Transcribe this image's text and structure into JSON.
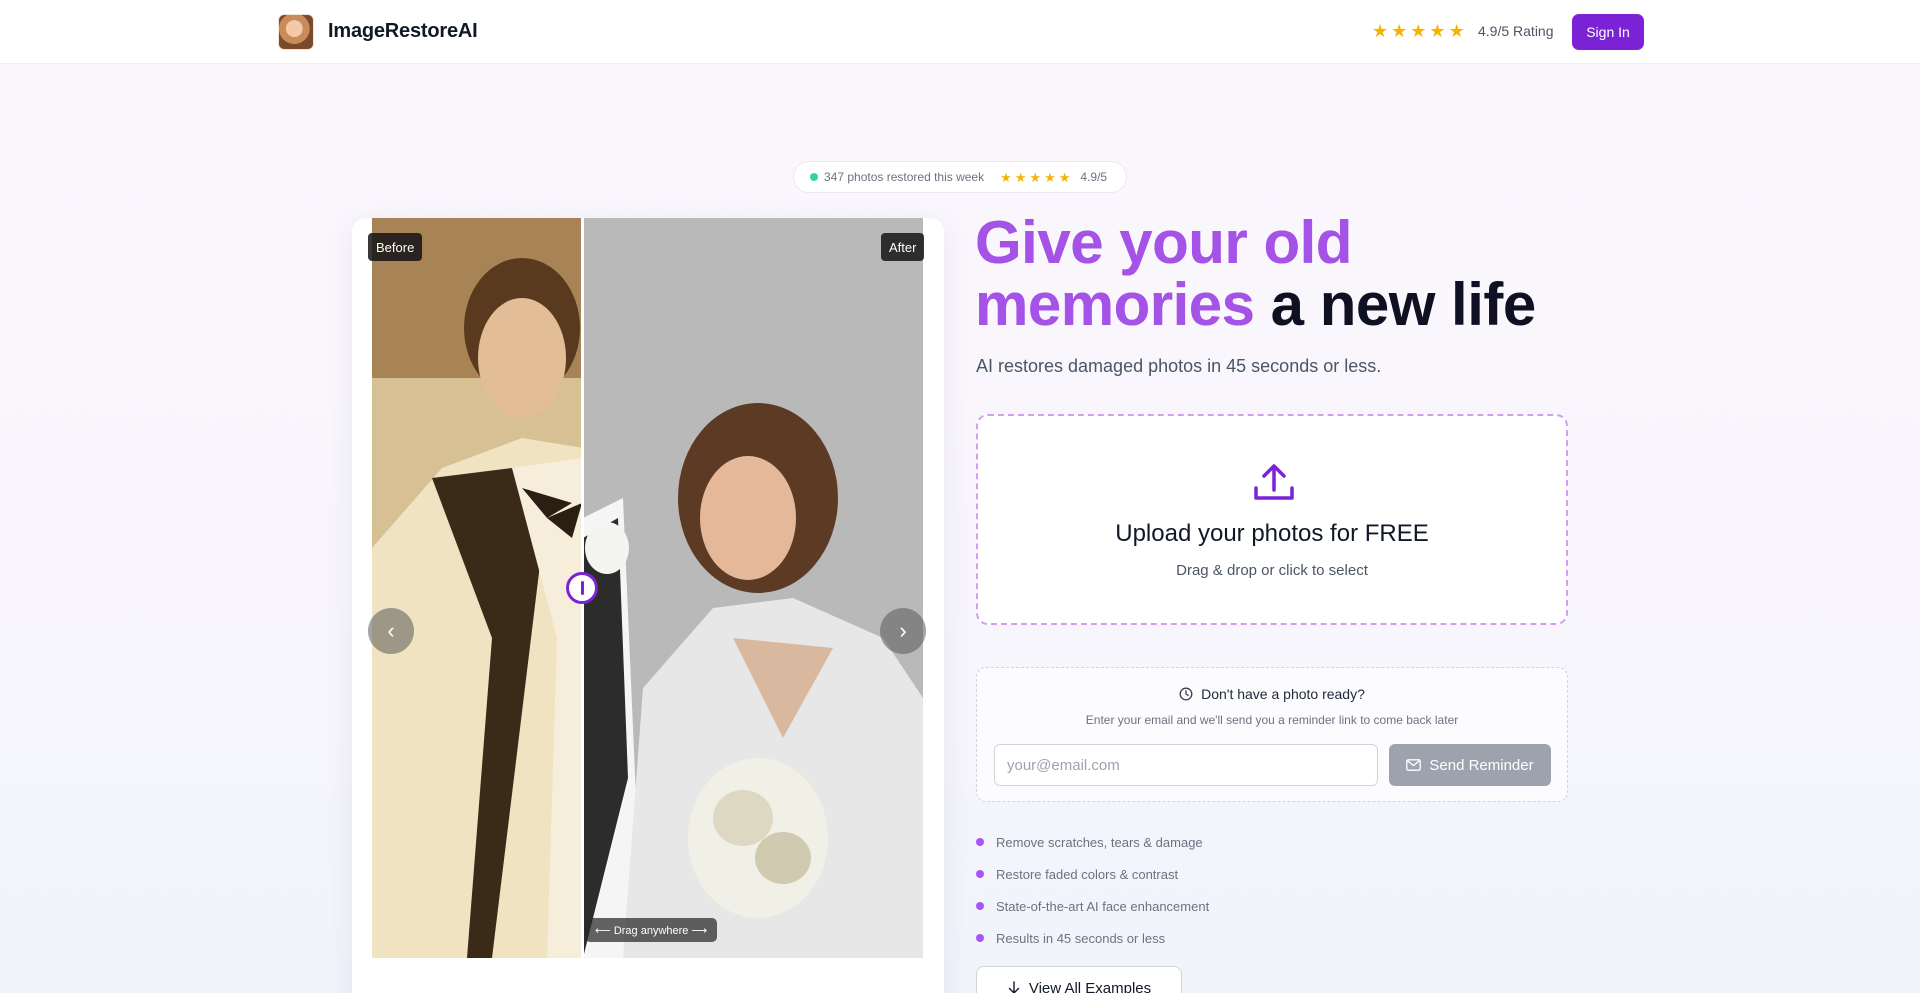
{
  "header": {
    "brand": "ImageRestoreAI",
    "stars": [
      "★",
      "★",
      "★",
      "★",
      "★"
    ],
    "rating_text": "4.9/5 Rating",
    "sign_in": "Sign In"
  },
  "pill": {
    "text": "347 photos restored this week",
    "stars": [
      "★",
      "★",
      "★",
      "★",
      "★"
    ],
    "rating": "4.9/5"
  },
  "comparison": {
    "before_label": "Before",
    "after_label": "After",
    "prev": "‹",
    "next": "›",
    "drag_hint": "⟵ Drag anywhere ⟶"
  },
  "hero": {
    "headline_accent_1": "Give your old",
    "headline_accent_2": "memories",
    "headline_dark": "a new life",
    "subhead": "AI restores damaged photos in 45 seconds or less."
  },
  "upload": {
    "title": "Upload your photos for FREE",
    "subtitle": "Drag & drop or click to select"
  },
  "reminder": {
    "title": "Don't have a photo ready?",
    "subtitle": "Enter your email and we'll send you a reminder link to come back later",
    "email_placeholder": "your@email.com",
    "send_label": "Send Reminder"
  },
  "features": [
    "Remove scratches, tears & damage",
    "Restore faded colors & contrast",
    "State-of-the-art AI face enhancement",
    "Results in 45 seconds or less"
  ],
  "view_examples": "View All Examples",
  "colors": {
    "accent": "#7c22d6",
    "headline_gradient": "#a453e6",
    "star": "#f5b400",
    "live_dot": "#34d399"
  }
}
